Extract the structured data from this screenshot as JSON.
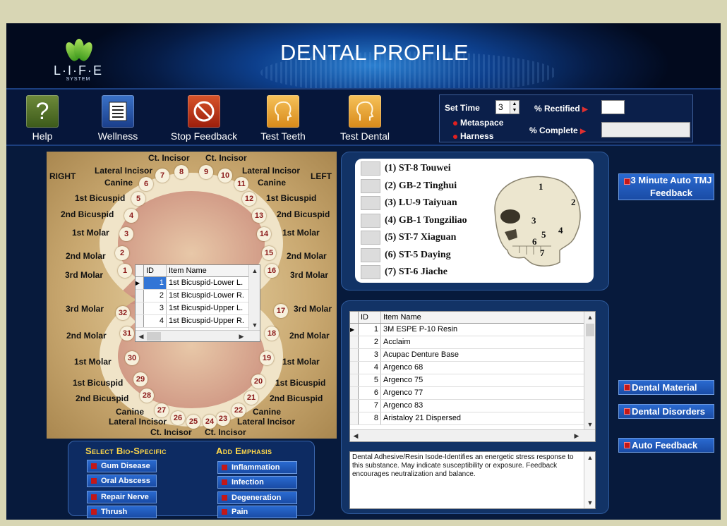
{
  "header": {
    "title": "DENTAL PROFILE",
    "logo_text": "L·I·F·E",
    "logo_sub": "SYSTEM"
  },
  "toolbar": {
    "buttons": [
      {
        "label": "Help",
        "icon": "help-icon"
      },
      {
        "label": "Wellness",
        "icon": "list-icon"
      },
      {
        "label": "Stop Feedback",
        "icon": "stop-icon"
      },
      {
        "label": "Test Teeth",
        "icon": "head-icon"
      },
      {
        "label": "Test Dental",
        "icon": "head-icon"
      }
    ]
  },
  "settings": {
    "set_time_label": "Set Time",
    "set_time_value": "3",
    "radio1": "Metaspace",
    "radio2": "Harness",
    "rectified_label": "% Rectified",
    "complete_label": "% Complete",
    "rectified_value": "",
    "complete_value": ""
  },
  "teeth_chart": {
    "side_left": "RIGHT",
    "side_right": "LEFT",
    "labels": {
      "ct_incisor": "Ct. Incisor",
      "lateral_incisor": "Lateral Incisor",
      "canine": "Canine",
      "bicuspid1": "1st Bicuspid",
      "bicuspid2": "2nd Bicuspid",
      "molar1": "1st Molar",
      "molar2": "2nd Molar",
      "molar3": "3rd Molar"
    }
  },
  "teeth_grid": {
    "headers": [
      "ID",
      "Item Name"
    ],
    "rows": [
      {
        "id": "1",
        "name": "1st Bicuspid-Lower L."
      },
      {
        "id": "2",
        "name": "1st Bicuspid-Lower R."
      },
      {
        "id": "3",
        "name": "1st Bicuspid-Upper L."
      },
      {
        "id": "4",
        "name": "1st Bicuspid-Upper R."
      }
    ]
  },
  "points": [
    "(1) ST-8 Touwei",
    "(2) GB-2 Tinghui",
    "(3) LU-9 Taiyuan",
    "(4) GB-1 Tongziliao",
    "(5) ST-7 Xiaguan",
    "(6) ST-5 Daying",
    "(7) ST-6 Jiache"
  ],
  "skull_numbers": [
    "1",
    "2",
    "3",
    "4",
    "5",
    "6",
    "7"
  ],
  "material_grid": {
    "headers": [
      "ID",
      "Item Name"
    ],
    "rows": [
      {
        "id": "1",
        "name": "3M ESPE P-10 Resin"
      },
      {
        "id": "2",
        "name": "Acclaim"
      },
      {
        "id": "3",
        "name": "Acupac Denture Base"
      },
      {
        "id": "4",
        "name": "Argenco 68"
      },
      {
        "id": "5",
        "name": "Argenco 75"
      },
      {
        "id": "6",
        "name": "Argenco 77"
      },
      {
        "id": "7",
        "name": "Argenco 83"
      },
      {
        "id": "8",
        "name": "Aristaloy 21 Dispersed"
      }
    ]
  },
  "description": "Dental Adhesive/Resin Isode-Identifies an energetic stress response to this substance. May indicate susceptibility or exposure. Feedback encourages neutralization and balance.",
  "side_buttons": {
    "tmj": "3 Minute Auto TMJ Feedback",
    "material": "Dental Material",
    "disorders": "Dental Disorders",
    "auto": "Auto Feedback"
  },
  "bio": {
    "select_head": "Select Bio-Specific",
    "emphasis_head": "Add Emphasis",
    "select": [
      "Gum Disease",
      "Oral Abscess",
      "Repair Nerve",
      "Thrush"
    ],
    "emphasis": [
      "Inflammation",
      "Infection",
      "Degeneration",
      "Pain"
    ]
  },
  "colors": {
    "background": "#071a3c",
    "accent_red": "#c41818",
    "button_blue": "#1a4ca6",
    "heading_yellow": "#ffd84a"
  }
}
